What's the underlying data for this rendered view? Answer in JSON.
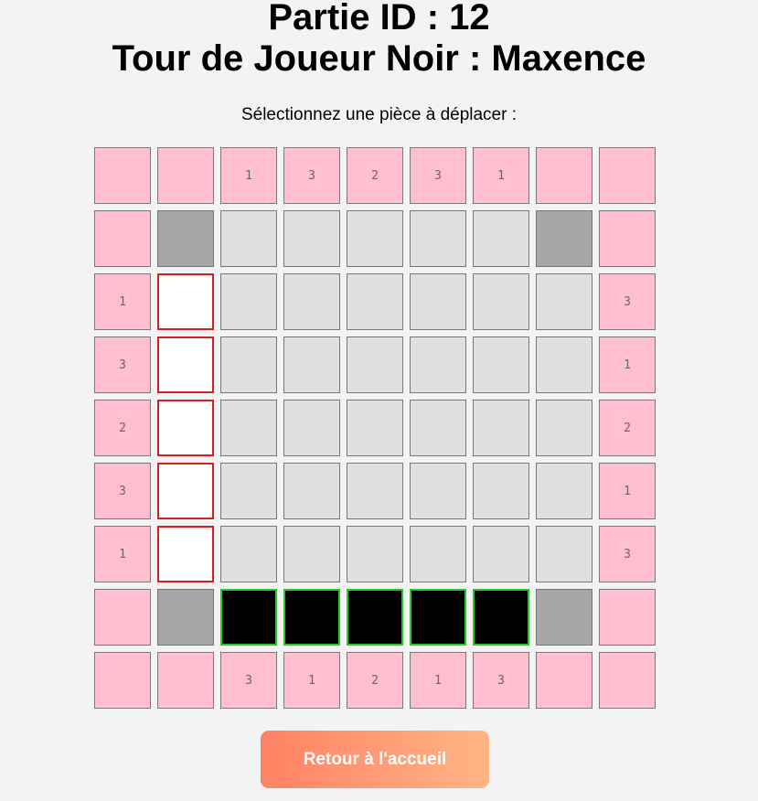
{
  "header": {
    "game_id_title": "Partie ID : 12",
    "turn_title": "Tour de Joueur Noir : Maxence",
    "instruction": "Sélectionnez une pièce à déplacer :"
  },
  "colors": {
    "border_cell": "#ffbfd0",
    "empty_cell": "#e0e0e0",
    "corner_cell": "#a6a6a6",
    "white_piece": "#ffffff",
    "white_piece_outline": "#d61e1e",
    "black_piece": "#000000",
    "black_piece_outline": "#22cc22"
  },
  "board": {
    "size": 9,
    "legend": "P = pink border cell, E = empty cell, C = gray corner cell, W = white piece, B = black piece (selectable)",
    "rows": [
      [
        "P",
        "P",
        "P",
        "P",
        "P",
        "P",
        "P",
        "P",
        "P"
      ],
      [
        "P",
        "C",
        "E",
        "E",
        "E",
        "E",
        "E",
        "C",
        "P"
      ],
      [
        "P",
        "W",
        "E",
        "E",
        "E",
        "E",
        "E",
        "E",
        "P"
      ],
      [
        "P",
        "W",
        "E",
        "E",
        "E",
        "E",
        "E",
        "E",
        "P"
      ],
      [
        "P",
        "W",
        "E",
        "E",
        "E",
        "E",
        "E",
        "E",
        "P"
      ],
      [
        "P",
        "W",
        "E",
        "E",
        "E",
        "E",
        "E",
        "E",
        "P"
      ],
      [
        "P",
        "W",
        "E",
        "E",
        "E",
        "E",
        "E",
        "E",
        "P"
      ],
      [
        "P",
        "C",
        "B",
        "B",
        "B",
        "B",
        "B",
        "C",
        "P"
      ],
      [
        "P",
        "P",
        "P",
        "P",
        "P",
        "P",
        "P",
        "P",
        "P"
      ]
    ],
    "labels": [
      [
        "",
        "",
        "1",
        "3",
        "2",
        "3",
        "1",
        "",
        ""
      ],
      [
        "",
        "",
        "",
        "",
        "",
        "",
        "",
        "",
        ""
      ],
      [
        "1",
        "",
        "",
        "",
        "",
        "",
        "",
        "",
        "3"
      ],
      [
        "3",
        "",
        "",
        "",
        "",
        "",
        "",
        "",
        "1"
      ],
      [
        "2",
        "",
        "",
        "",
        "",
        "",
        "",
        "",
        "2"
      ],
      [
        "3",
        "",
        "",
        "",
        "",
        "",
        "",
        "",
        "1"
      ],
      [
        "1",
        "",
        "",
        "",
        "",
        "",
        "",
        "",
        "3"
      ],
      [
        "",
        "",
        "",
        "",
        "",
        "",
        "",
        "",
        ""
      ],
      [
        "",
        "",
        "3",
        "1",
        "2",
        "1",
        "3",
        "",
        ""
      ]
    ]
  },
  "footer": {
    "home_button_label": "Retour à l'accueil"
  }
}
